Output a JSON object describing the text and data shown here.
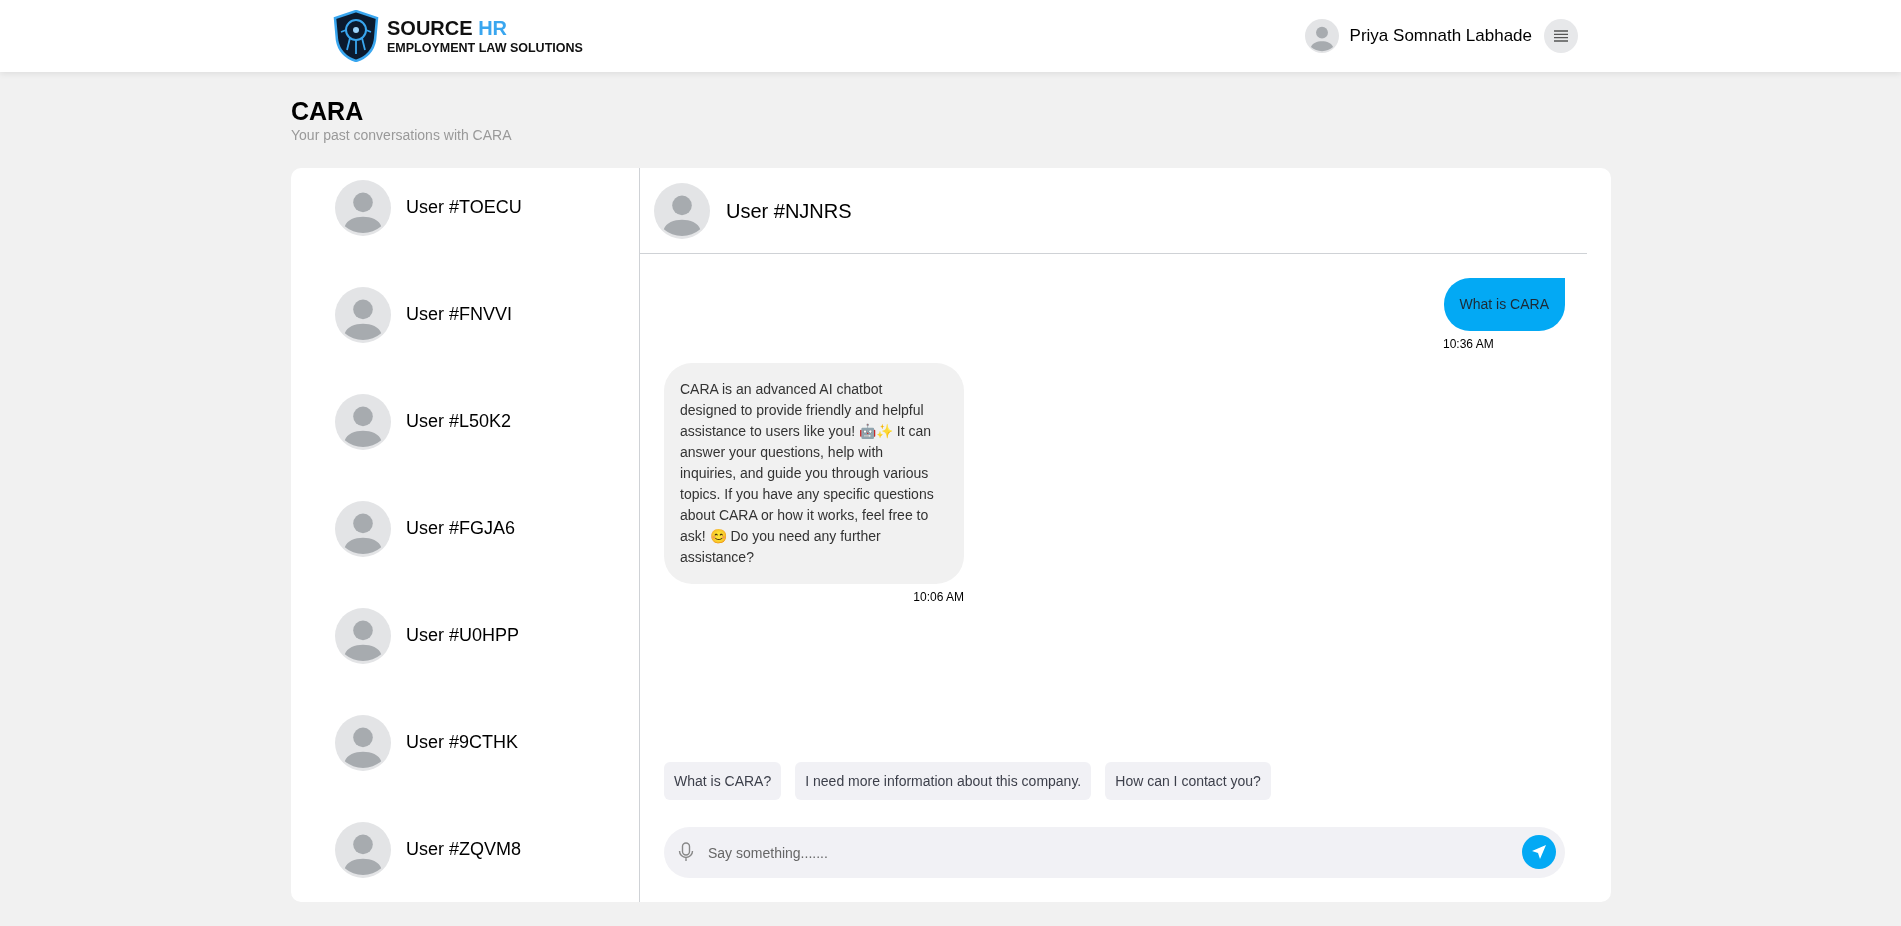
{
  "header": {
    "brand": {
      "name": "SOURCE",
      "name_accent": "HR",
      "tagline": "EMPLOYMENT LAW SOLUTIONS"
    },
    "user_name": "Priya Somnath Labhade"
  },
  "page": {
    "title": "CARA",
    "subtitle": "Your past conversations with CARA"
  },
  "conversations": [
    {
      "name": "User #TOECU"
    },
    {
      "name": "User #FNVVI"
    },
    {
      "name": "User #L50K2"
    },
    {
      "name": "User #FGJA6"
    },
    {
      "name": "User #U0HPP"
    },
    {
      "name": "User #9CTHK"
    },
    {
      "name": "User #ZQVM8"
    }
  ],
  "chat": {
    "title": "User #NJNRS",
    "messages": [
      {
        "kind": "user",
        "text": "What is CARA",
        "time": "10:36 AM"
      },
      {
        "kind": "bot",
        "text": "CARA is an advanced AI chatbot designed to provide friendly and helpful assistance to users like you! 🤖✨ It can answer your questions, help with inquiries, and guide you through various topics. If you have any specific questions about CARA or how it works, feel free to ask! 😊 Do you need any further assistance?",
        "time": "10:06 AM"
      }
    ],
    "suggestions": [
      "What is CARA?",
      "I need more information about this company.",
      "How can I contact you?"
    ],
    "input": {
      "placeholder": "Say something......."
    }
  }
}
